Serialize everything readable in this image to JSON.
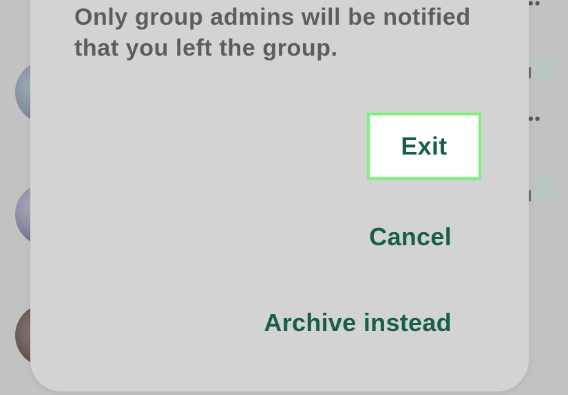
{
  "dialog": {
    "message": "Only group admins will be notified that you left the group.",
    "buttons": {
      "exit": "Exit",
      "cancel": "Cancel",
      "archive": "Archive instead"
    }
  },
  "colors": {
    "button_text": "#175e4d",
    "highlight_border": "#7cf27a",
    "dialog_background": "#d3d3d3",
    "message_text": "#5d5d5d"
  },
  "background_list": {
    "icons": [
      "more-options-icon",
      "more-options-icon"
    ]
  }
}
